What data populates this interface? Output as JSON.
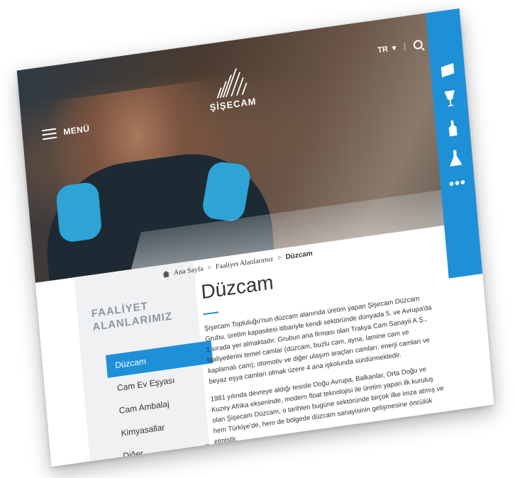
{
  "header": {
    "menu_label": "MENÜ",
    "logo_text": "ŞİŞECAM",
    "language": "TR",
    "language_chevron": "▾"
  },
  "side_rail": {
    "icons": [
      "flat-glass-icon",
      "glassware-icon",
      "bottle-icon",
      "flask-icon"
    ],
    "more_label": "•••"
  },
  "breadcrumb": {
    "separator": ">",
    "items": [
      "Ana Sayfa",
      "Faaliyet Alanlarımız",
      "Düzcam"
    ]
  },
  "sidebar": {
    "title_line1": "FAALİYET",
    "title_line2": "ALANLARIMIZ",
    "items": [
      {
        "label": "Düzcam"
      },
      {
        "label": "Cam Ev Eşyası"
      },
      {
        "label": "Cam Ambalaj"
      },
      {
        "label": "Kimyasallar"
      },
      {
        "label": "Diğer",
        "chevron": "⌄"
      }
    ]
  },
  "content": {
    "title": "Düzcam",
    "paragraphs": [
      "Şişecam Topluluğu'nun düzcam alanında üretim yapan Şişecam Düzcam Grubu, üretim kapasitesi itibariyle kendi sektöründe dünyada 5. ve Avrupa'da 1.sırada yer almaktadır. Grubun ana firması olan Trakya Cam Sanayii A.Ş., faaliyetlerini temel camlar (düzcam, buzlu cam, ayna, lamine cam ve kaplamalı cam); otomotiv ve diğer ulaşım araçları camları; enerji camları ve beyaz eşya camları olmak üzere 4 ana işkolunda sürdürmektedir.",
      "1981 yılında devreye aldığı tesisle Doğu Avrupa, Balkanlar, Orta Doğu ve Kuzey Afrika ekseninde, modern float teknolojisi ile üretim yapan ilk kuruluş olan Şişecam Düzcam, o tarihten bugüne sektöründe birçok ilke imza atmış ve hem Türkiye'de, hem de bölgede düzcam sanayisinin gelişmesine öncülük etmiştir."
    ]
  },
  "colors": {
    "accent": "#1e90d8",
    "sidebar_bg": "#f0f1f2",
    "sidebar_title": "#8b96a0"
  }
}
